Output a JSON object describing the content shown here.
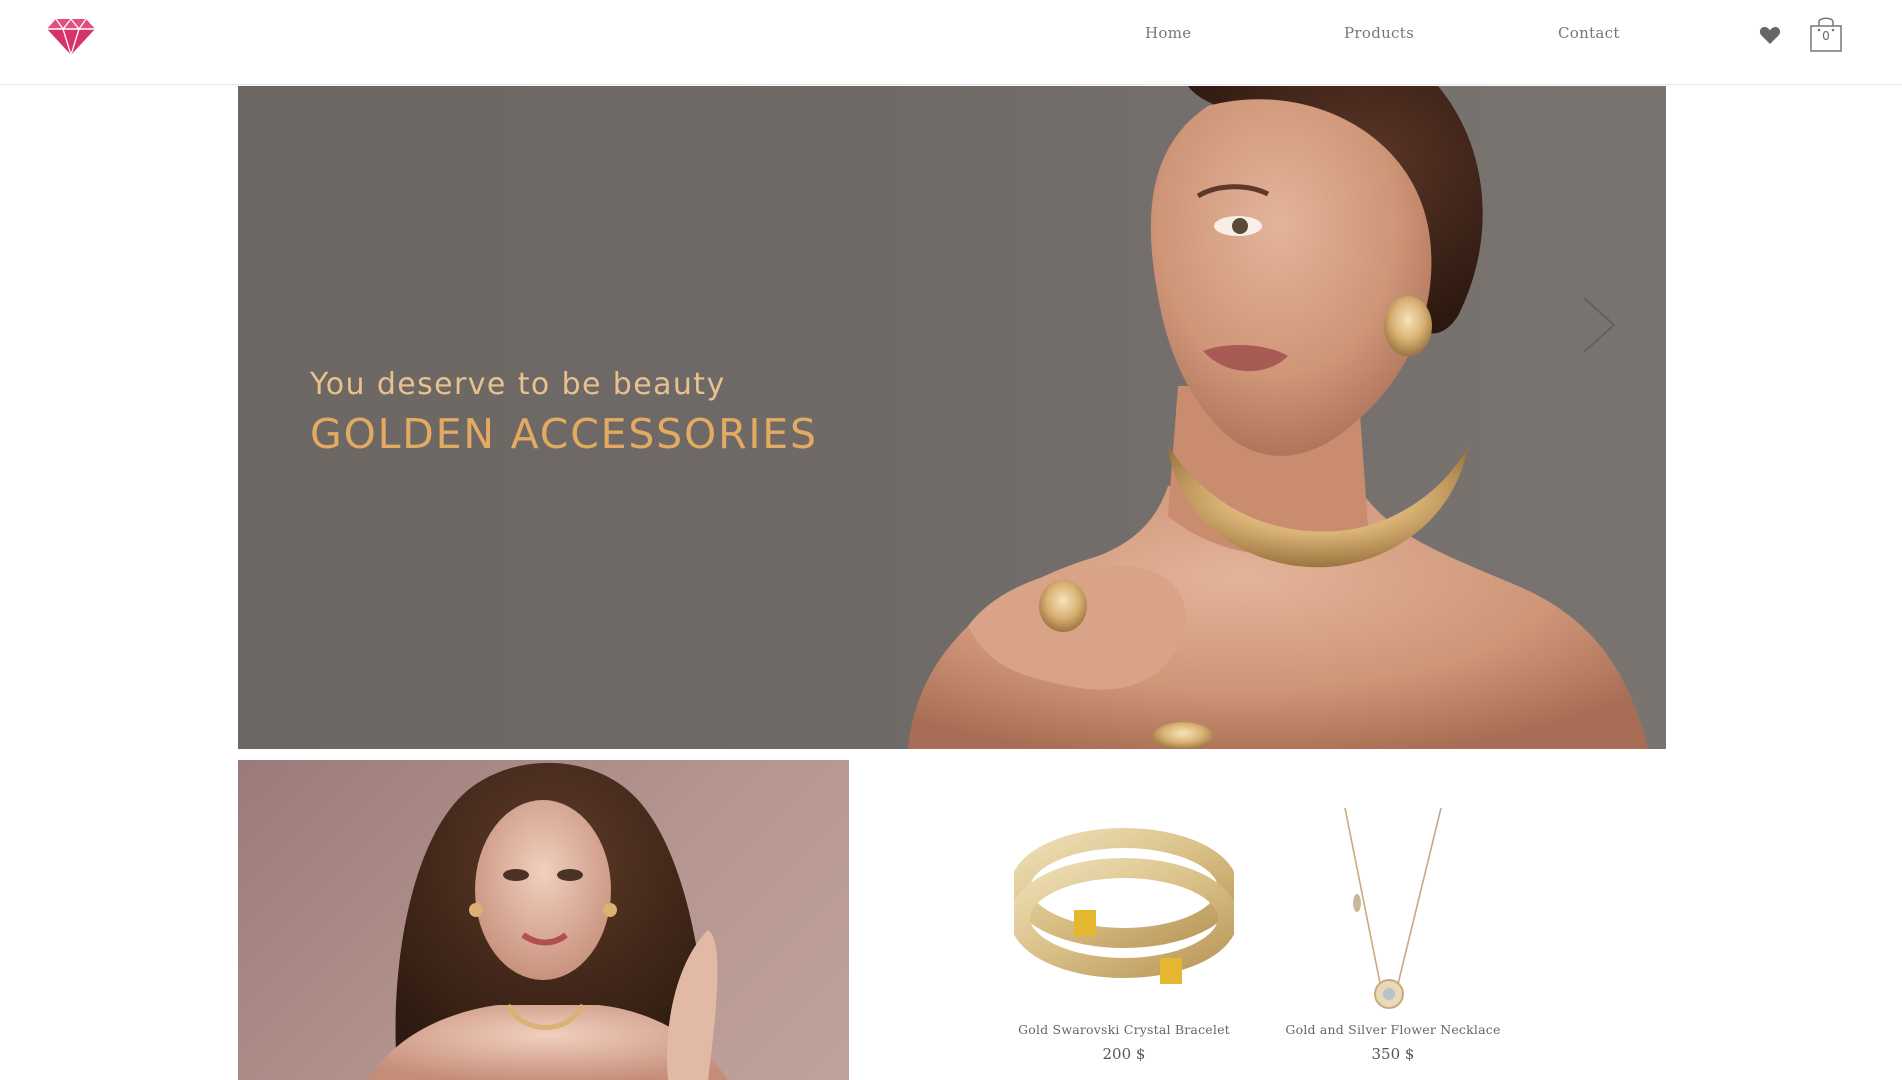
{
  "header": {
    "logo_icon": "diamond-icon",
    "nav": [
      {
        "label": "Home"
      },
      {
        "label": "Products"
      },
      {
        "label": "Contact"
      }
    ],
    "wishlist_icon": "heart-icon",
    "cart": {
      "icon": "shopping-bag-icon",
      "count": "0"
    }
  },
  "hero": {
    "subtitle": "You deserve to be beauty",
    "title": "GOLDEN ACCESSORIES",
    "next_icon": "chevron-right-icon"
  },
  "products": [
    {
      "name": "Gold Swarovski Crystal Bracelet",
      "price": "200 $"
    },
    {
      "name": "Gold and Silver Flower Necklace",
      "price": "350 $"
    }
  ],
  "colors": {
    "brand": "#d6336c",
    "gold_text": "#e3aa62",
    "hero_bg": "#6f6a67",
    "promo_bg": "#b5958f"
  }
}
